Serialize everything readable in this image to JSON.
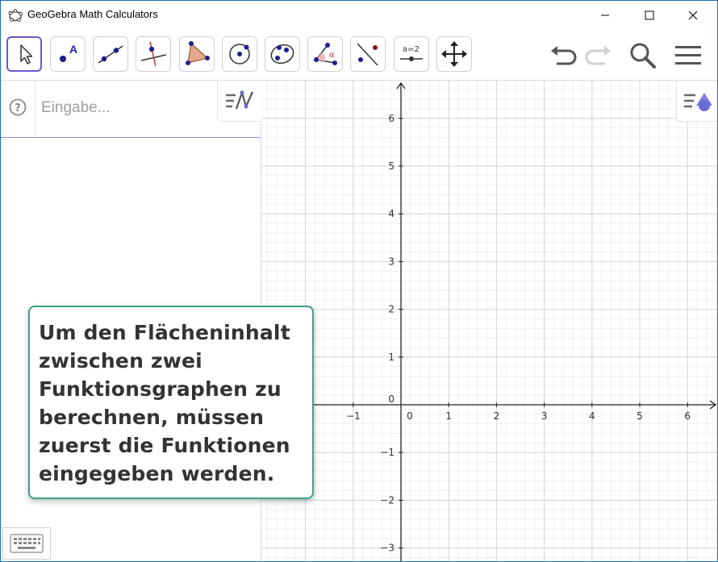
{
  "window": {
    "title": "GeoGebra Math Calculators",
    "controls": [
      "minimize",
      "maximize",
      "close"
    ]
  },
  "toolbar": {
    "tools": [
      {
        "name": "move-tool",
        "active": true
      },
      {
        "name": "point-tool",
        "label": "A"
      },
      {
        "name": "line-tool"
      },
      {
        "name": "perpendicular-line-tool"
      },
      {
        "name": "polygon-tool"
      },
      {
        "name": "circle-tool"
      },
      {
        "name": "ellipse-tool"
      },
      {
        "name": "angle-tool",
        "label": "α"
      },
      {
        "name": "reflect-tool"
      },
      {
        "name": "slider-tool",
        "label": "a=2"
      },
      {
        "name": "move-graphics-tool"
      }
    ],
    "right": [
      "undo-icon",
      "redo-icon",
      "search-icon",
      "menu-icon"
    ]
  },
  "algebra": {
    "input_placeholder": "Eingabe...",
    "help_icon": "question-icon"
  },
  "graphics": {
    "x_ticks": [
      "−1",
      "0",
      "1",
      "2",
      "3",
      "4",
      "5",
      "6"
    ],
    "y_ticks": [
      "6",
      "5",
      "4",
      "3",
      "2",
      "1",
      "0",
      "−1",
      "−2",
      "−3"
    ]
  },
  "tooltip": {
    "lines": [
      "Um den Flächeninhalt",
      "zwischen zwei",
      "Funktionsgraphen zu",
      "berechnen, müssen",
      "zuerst die Funktionen",
      "eingegeben werden."
    ]
  },
  "colors": {
    "accent": "#6557d2",
    "tooltip_border": "#3ea08e",
    "window_border": "#1f6fb5"
  }
}
